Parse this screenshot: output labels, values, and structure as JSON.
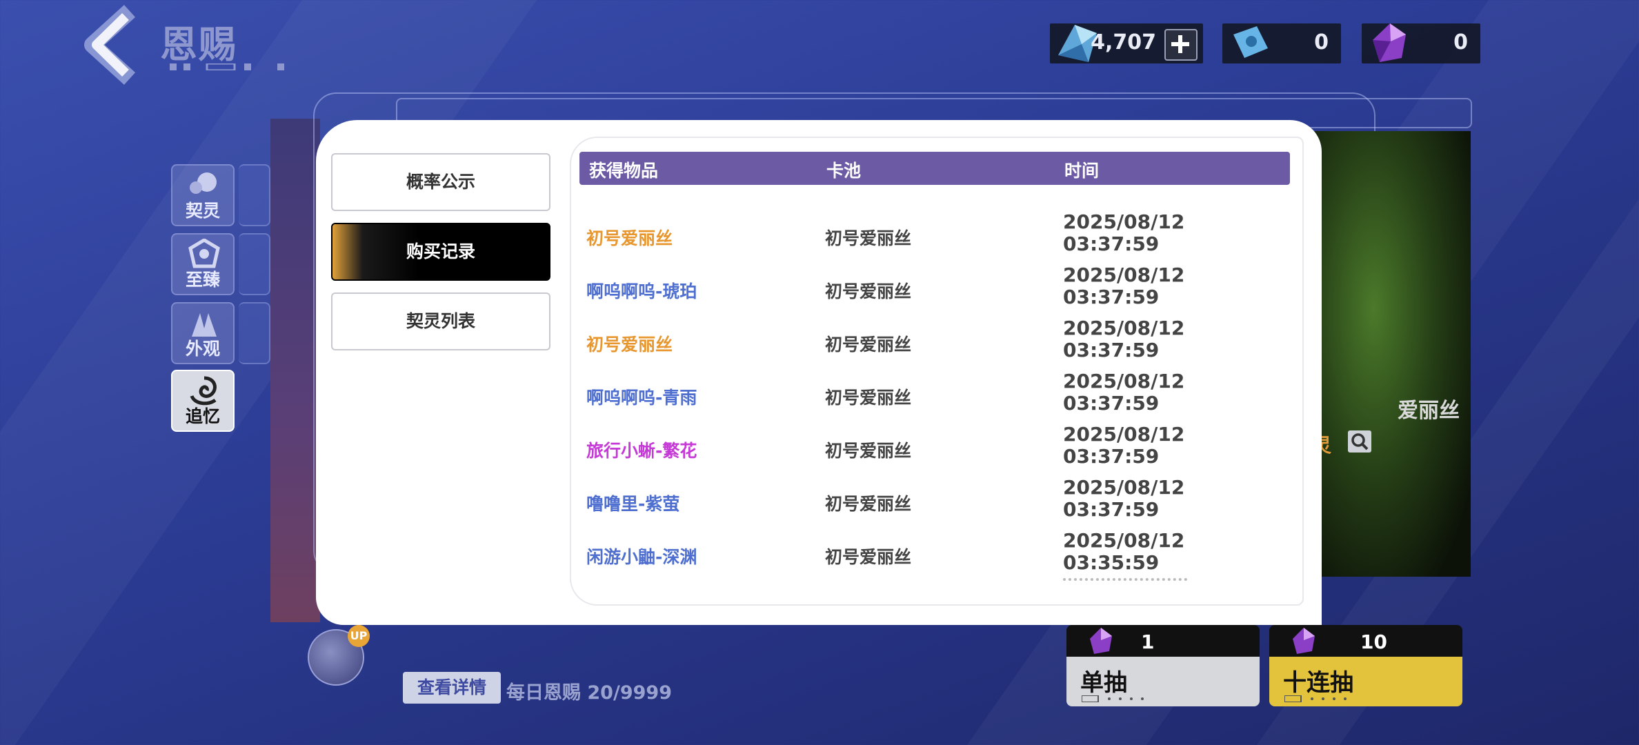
{
  "header": {
    "title": "恩赐",
    "currencies": [
      {
        "icon": "blue-crystal-icon",
        "value": "4,707",
        "has_plus": true
      },
      {
        "icon": "blue-ticket-icon",
        "value": "0"
      },
      {
        "icon": "purple-gem-icon",
        "value": "0"
      }
    ]
  },
  "sidebar": {
    "items": [
      {
        "label": "契灵",
        "icon": "pet-icon"
      },
      {
        "label": "至臻",
        "icon": "crest-icon"
      },
      {
        "label": "外观",
        "icon": "outfit-icon"
      },
      {
        "label": "追忆",
        "icon": "swirl-icon",
        "active": true
      }
    ]
  },
  "modal": {
    "tabs": [
      {
        "label": "概率公示"
      },
      {
        "label": "购买记录",
        "active": true
      },
      {
        "label": "契灵列表"
      }
    ],
    "table": {
      "headers": [
        "获得物品",
        "卡池",
        "时间"
      ],
      "rows": [
        {
          "item": "初号爱丽丝",
          "pool": "初号爱丽丝",
          "date": "2025/08/12",
          "time": "03:37:59",
          "color": "#e8962e"
        },
        {
          "item": "啊呜啊呜-琥珀",
          "pool": "初号爱丽丝",
          "date": "2025/08/12",
          "time": "03:37:59",
          "color": "#4f6fd0"
        },
        {
          "item": "初号爱丽丝",
          "pool": "初号爱丽丝",
          "date": "2025/08/12",
          "time": "03:37:59",
          "color": "#e8962e"
        },
        {
          "item": "啊呜啊呜-青雨",
          "pool": "初号爱丽丝",
          "date": "2025/08/12",
          "time": "03:37:59",
          "color": "#4f6fd0"
        },
        {
          "item": "旅行小蜥-繁花",
          "pool": "初号爱丽丝",
          "date": "2025/08/12",
          "time": "03:37:59",
          "color": "#c53ad6"
        },
        {
          "item": "噜噜里-紫萤",
          "pool": "初号爱丽丝",
          "date": "2025/08/12",
          "time": "03:37:59",
          "color": "#4f6fd0"
        },
        {
          "item": "闲游小鼬-深渊",
          "pool": "初号爱丽丝",
          "date": "2025/08/12",
          "time": "03:35:59",
          "color": "#4f6fd0"
        }
      ]
    }
  },
  "banner": {
    "name_fragment": "爱丽丝",
    "tag_fragment": "灵"
  },
  "bottom": {
    "up_badge": "UP",
    "detail_button": "查看详情",
    "daily_text": "每日恩赐 20/9999",
    "single_draw": {
      "count": "1",
      "label": "单抽"
    },
    "ten_draw": {
      "count": "10",
      "label": "十连抽"
    }
  }
}
